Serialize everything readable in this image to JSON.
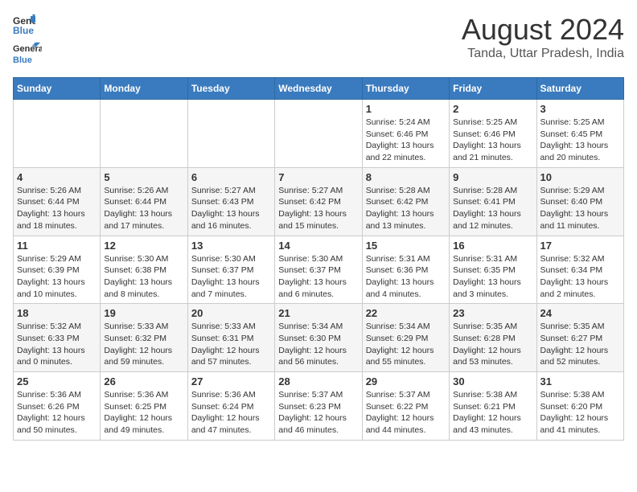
{
  "header": {
    "logo_general": "General",
    "logo_blue": "Blue",
    "title": "August 2024",
    "subtitle": "Tanda, Uttar Pradesh, India"
  },
  "days_of_week": [
    "Sunday",
    "Monday",
    "Tuesday",
    "Wednesday",
    "Thursday",
    "Friday",
    "Saturday"
  ],
  "weeks": [
    [
      {
        "day": "",
        "info": ""
      },
      {
        "day": "",
        "info": ""
      },
      {
        "day": "",
        "info": ""
      },
      {
        "day": "",
        "info": ""
      },
      {
        "day": "1",
        "info": "Sunrise: 5:24 AM\nSunset: 6:46 PM\nDaylight: 13 hours\nand 22 minutes."
      },
      {
        "day": "2",
        "info": "Sunrise: 5:25 AM\nSunset: 6:46 PM\nDaylight: 13 hours\nand 21 minutes."
      },
      {
        "day": "3",
        "info": "Sunrise: 5:25 AM\nSunset: 6:45 PM\nDaylight: 13 hours\nand 20 minutes."
      }
    ],
    [
      {
        "day": "4",
        "info": "Sunrise: 5:26 AM\nSunset: 6:44 PM\nDaylight: 13 hours\nand 18 minutes."
      },
      {
        "day": "5",
        "info": "Sunrise: 5:26 AM\nSunset: 6:44 PM\nDaylight: 13 hours\nand 17 minutes."
      },
      {
        "day": "6",
        "info": "Sunrise: 5:27 AM\nSunset: 6:43 PM\nDaylight: 13 hours\nand 16 minutes."
      },
      {
        "day": "7",
        "info": "Sunrise: 5:27 AM\nSunset: 6:42 PM\nDaylight: 13 hours\nand 15 minutes."
      },
      {
        "day": "8",
        "info": "Sunrise: 5:28 AM\nSunset: 6:42 PM\nDaylight: 13 hours\nand 13 minutes."
      },
      {
        "day": "9",
        "info": "Sunrise: 5:28 AM\nSunset: 6:41 PM\nDaylight: 13 hours\nand 12 minutes."
      },
      {
        "day": "10",
        "info": "Sunrise: 5:29 AM\nSunset: 6:40 PM\nDaylight: 13 hours\nand 11 minutes."
      }
    ],
    [
      {
        "day": "11",
        "info": "Sunrise: 5:29 AM\nSunset: 6:39 PM\nDaylight: 13 hours\nand 10 minutes."
      },
      {
        "day": "12",
        "info": "Sunrise: 5:30 AM\nSunset: 6:38 PM\nDaylight: 13 hours\nand 8 minutes."
      },
      {
        "day": "13",
        "info": "Sunrise: 5:30 AM\nSunset: 6:37 PM\nDaylight: 13 hours\nand 7 minutes."
      },
      {
        "day": "14",
        "info": "Sunrise: 5:30 AM\nSunset: 6:37 PM\nDaylight: 13 hours\nand 6 minutes."
      },
      {
        "day": "15",
        "info": "Sunrise: 5:31 AM\nSunset: 6:36 PM\nDaylight: 13 hours\nand 4 minutes."
      },
      {
        "day": "16",
        "info": "Sunrise: 5:31 AM\nSunset: 6:35 PM\nDaylight: 13 hours\nand 3 minutes."
      },
      {
        "day": "17",
        "info": "Sunrise: 5:32 AM\nSunset: 6:34 PM\nDaylight: 13 hours\nand 2 minutes."
      }
    ],
    [
      {
        "day": "18",
        "info": "Sunrise: 5:32 AM\nSunset: 6:33 PM\nDaylight: 13 hours\nand 0 minutes."
      },
      {
        "day": "19",
        "info": "Sunrise: 5:33 AM\nSunset: 6:32 PM\nDaylight: 12 hours\nand 59 minutes."
      },
      {
        "day": "20",
        "info": "Sunrise: 5:33 AM\nSunset: 6:31 PM\nDaylight: 12 hours\nand 57 minutes."
      },
      {
        "day": "21",
        "info": "Sunrise: 5:34 AM\nSunset: 6:30 PM\nDaylight: 12 hours\nand 56 minutes."
      },
      {
        "day": "22",
        "info": "Sunrise: 5:34 AM\nSunset: 6:29 PM\nDaylight: 12 hours\nand 55 minutes."
      },
      {
        "day": "23",
        "info": "Sunrise: 5:35 AM\nSunset: 6:28 PM\nDaylight: 12 hours\nand 53 minutes."
      },
      {
        "day": "24",
        "info": "Sunrise: 5:35 AM\nSunset: 6:27 PM\nDaylight: 12 hours\nand 52 minutes."
      }
    ],
    [
      {
        "day": "25",
        "info": "Sunrise: 5:36 AM\nSunset: 6:26 PM\nDaylight: 12 hours\nand 50 minutes."
      },
      {
        "day": "26",
        "info": "Sunrise: 5:36 AM\nSunset: 6:25 PM\nDaylight: 12 hours\nand 49 minutes."
      },
      {
        "day": "27",
        "info": "Sunrise: 5:36 AM\nSunset: 6:24 PM\nDaylight: 12 hours\nand 47 minutes."
      },
      {
        "day": "28",
        "info": "Sunrise: 5:37 AM\nSunset: 6:23 PM\nDaylight: 12 hours\nand 46 minutes."
      },
      {
        "day": "29",
        "info": "Sunrise: 5:37 AM\nSunset: 6:22 PM\nDaylight: 12 hours\nand 44 minutes."
      },
      {
        "day": "30",
        "info": "Sunrise: 5:38 AM\nSunset: 6:21 PM\nDaylight: 12 hours\nand 43 minutes."
      },
      {
        "day": "31",
        "info": "Sunrise: 5:38 AM\nSunset: 6:20 PM\nDaylight: 12 hours\nand 41 minutes."
      }
    ]
  ]
}
